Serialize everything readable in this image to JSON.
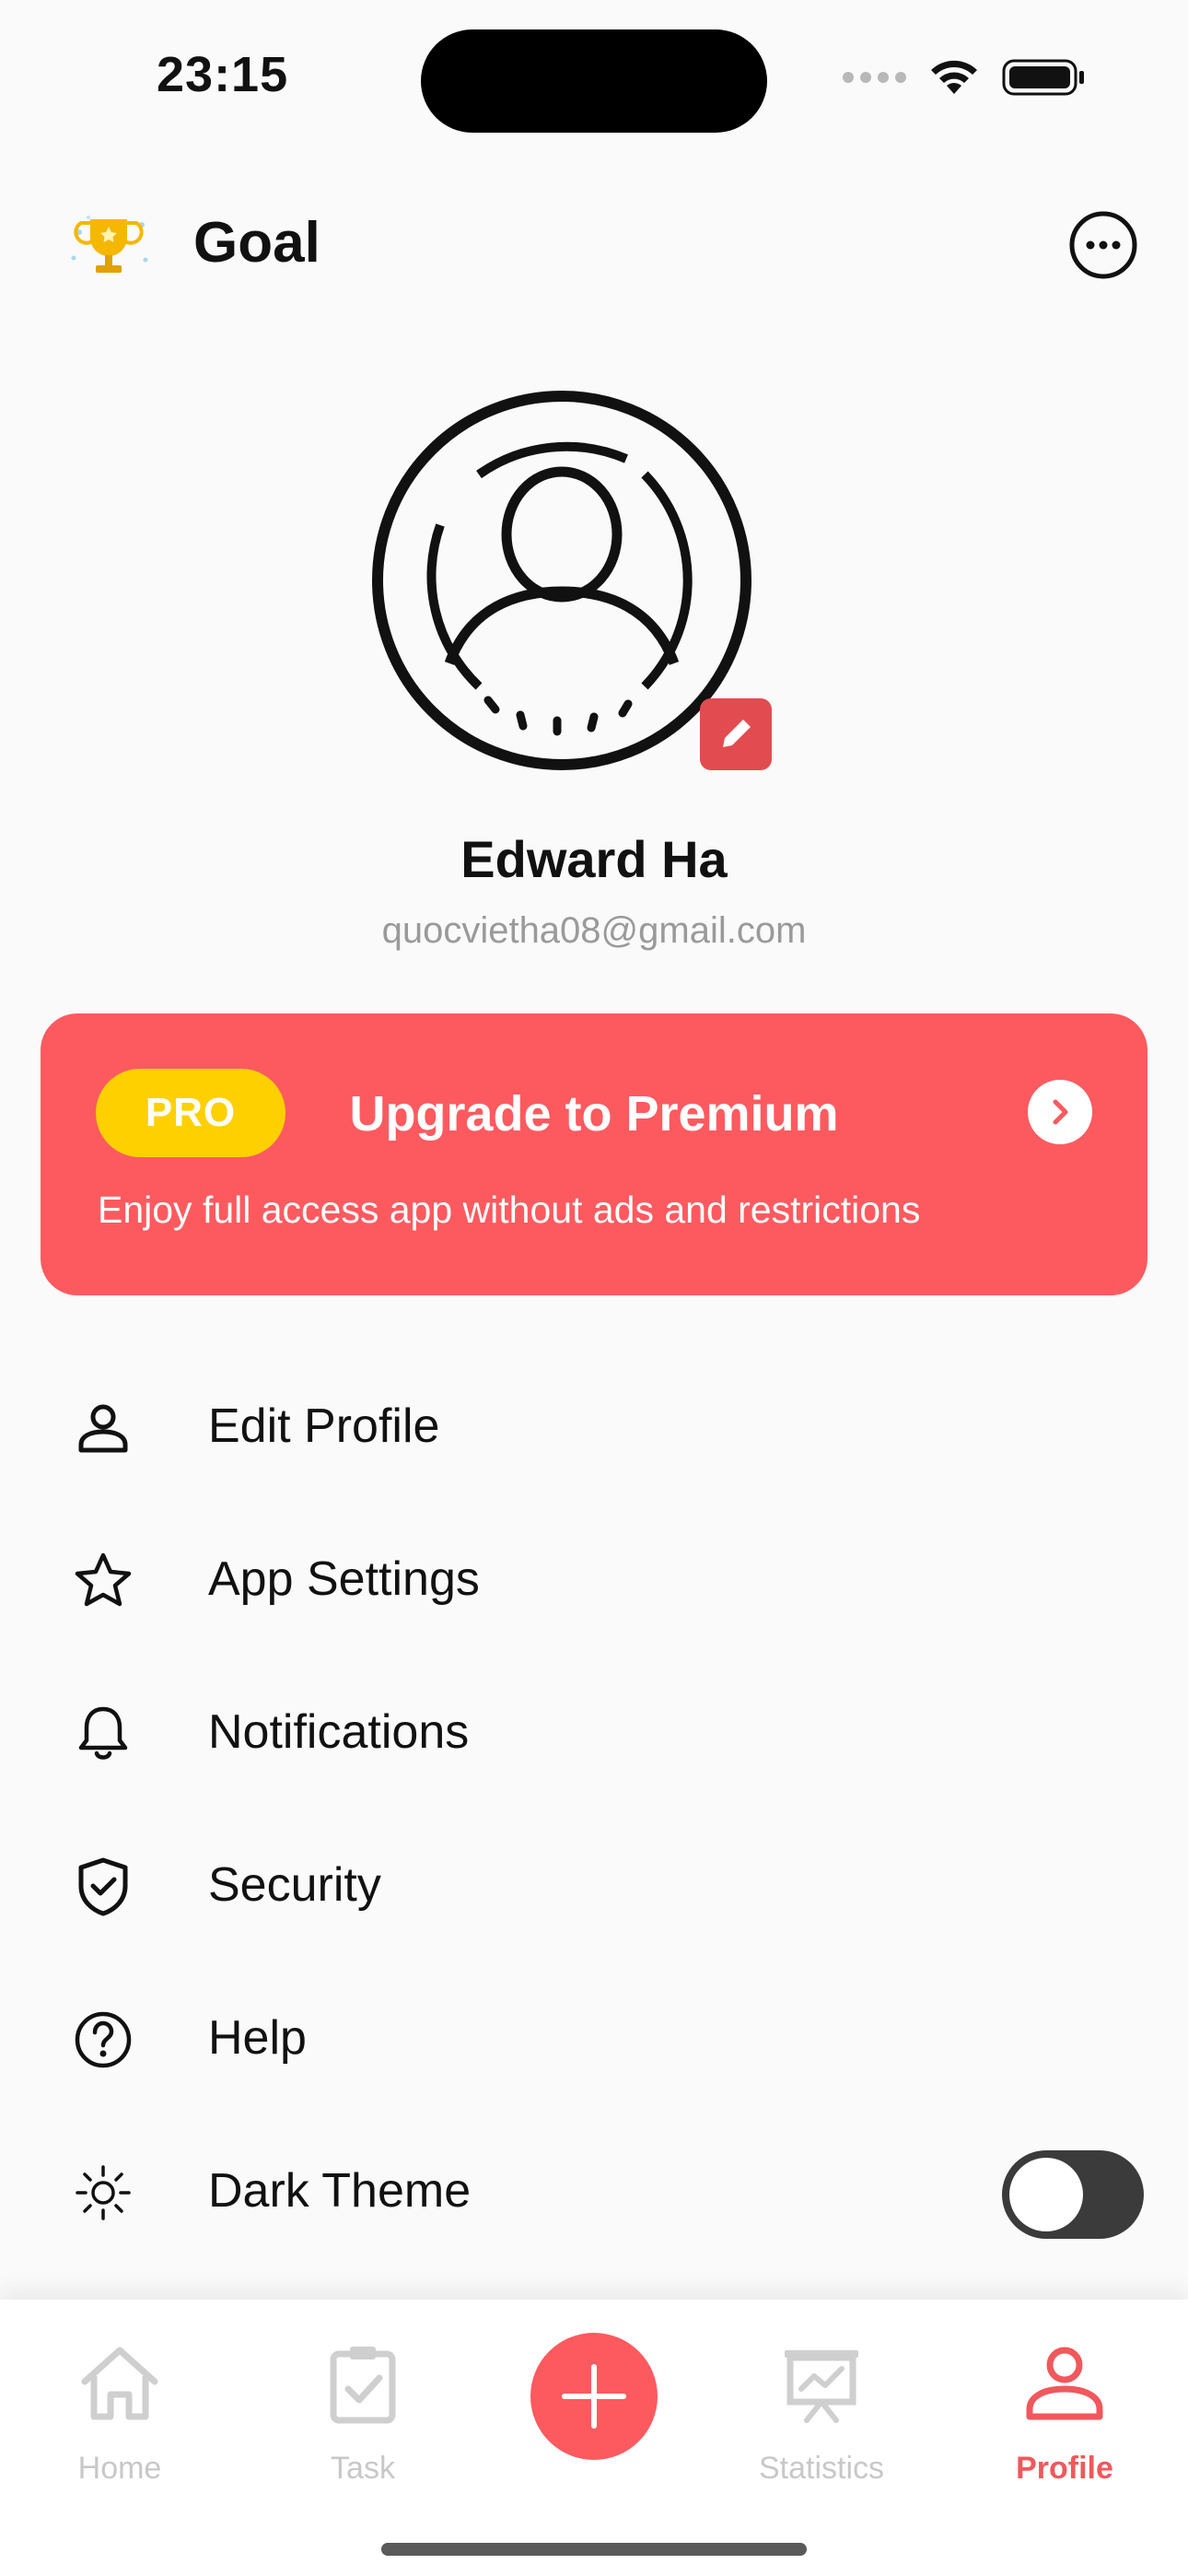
{
  "status_bar": {
    "time": "23:15",
    "icons": [
      "cellular-signal-icon",
      "wifi-icon",
      "battery-icon"
    ]
  },
  "header": {
    "title": "Goal",
    "logo_icon": "trophy-icon",
    "more_icon": "more-horizontal-icon"
  },
  "profile": {
    "name": "Edward Ha",
    "email": "quocvietha08@gmail.com",
    "avatar_icon": "user-avatar-icon",
    "edit_icon": "pencil-icon"
  },
  "premium": {
    "badge": "PRO",
    "title": "Upgrade to Premium",
    "subtitle": "Enjoy full access app without ads and restrictions",
    "arrow_icon": "chevron-right-icon"
  },
  "menu": [
    {
      "label": "Edit Profile",
      "icon": "person-icon"
    },
    {
      "label": "App Settings",
      "icon": "star-icon"
    },
    {
      "label": "Notifications",
      "icon": "bell-icon"
    },
    {
      "label": "Security",
      "icon": "shield-check-icon"
    },
    {
      "label": "Help",
      "icon": "help-circle-icon"
    },
    {
      "label": "Dark Theme",
      "icon": "sun-icon",
      "toggle": false
    }
  ],
  "tabs": [
    {
      "label": "Home",
      "icon": "home-icon",
      "active": false
    },
    {
      "label": "Task",
      "icon": "task-icon",
      "active": false
    },
    {
      "label": "Statistics",
      "icon": "statistics-icon",
      "active": false
    },
    {
      "label": "Profile",
      "icon": "profile-icon",
      "active": true
    }
  ],
  "fab": {
    "icon": "plus-icon"
  },
  "colors": {
    "accent": "#fd5a5f",
    "pro_badge": "#ffd000",
    "active_tab": "#f0585c",
    "inactive_tab": "#c8c8c8",
    "background": "#fafafa"
  }
}
